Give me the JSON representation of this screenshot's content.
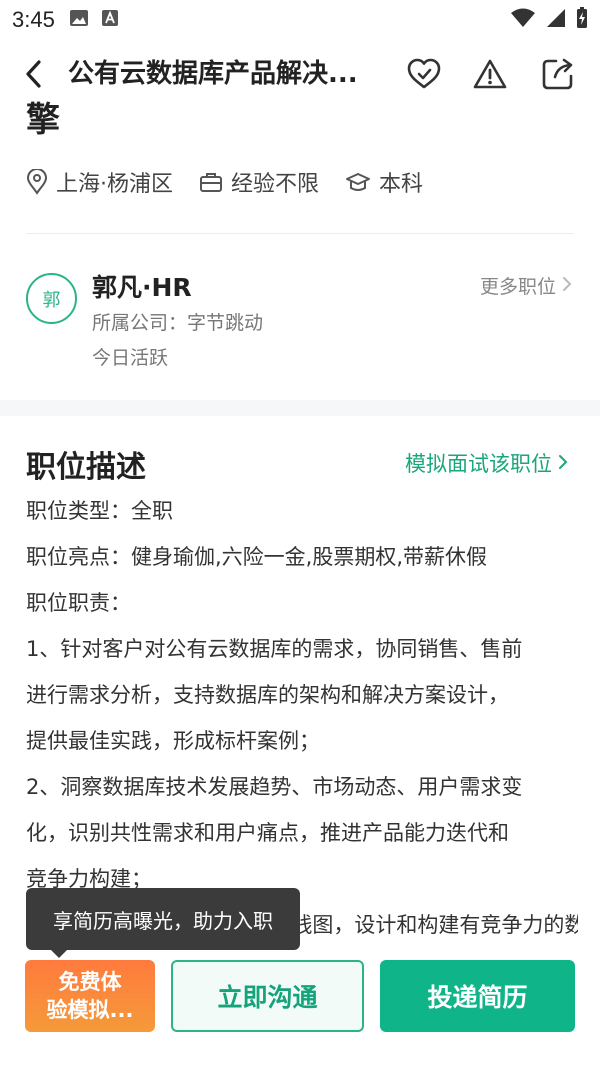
{
  "status_bar": {
    "time": "3:45",
    "icons": [
      "gallery-icon",
      "font-a-icon",
      "wifi-icon",
      "signal-icon",
      "battery-charging-icon"
    ]
  },
  "nav": {
    "title": "公有云数据库产品解决...",
    "icons": [
      "back-arrow-icon",
      "heart-check-icon",
      "warning-icon",
      "share-icon"
    ]
  },
  "job": {
    "title_tail": "擎",
    "location": "上海·杨浦区",
    "experience": "经验不限",
    "education": "本科"
  },
  "hr": {
    "avatar_text": "郭",
    "name": "郭凡·HR",
    "company": "所属公司：字节跳动",
    "activity": "今日活跃",
    "more_jobs": "更多职位"
  },
  "description": {
    "section_title": "职位描述",
    "mock_interview_link": "模拟面试该职位",
    "lines": [
      "职位类型：全职",
      "职位亮点：健身瑜伽,六险一金,股票期权,带薪休假",
      "职位职责：",
      "1、针对客户对公有云数据库的需求，协同销售、售前",
      "进行需求分析，支持数据库的架构和解决方案设计，",
      "提供最佳实践，形成标杆案例；",
      "2、洞察数据库技术发展趋势、市场动态、用户需求变",
      "化，识别共性需求和用户痛点，推进产品能力迭代和",
      "竞争力构建；",
      "3、负责产品的整体规划和路线图，设计和构建有竞争力的数"
    ]
  },
  "tooltip": {
    "text": "享简历高曝光，助力入职"
  },
  "buttons": {
    "trial_line1": "免费体",
    "trial_line2": "验模拟...",
    "chat": "立即沟通",
    "apply": "投递简历"
  },
  "colors": {
    "accent_green": "#0fb488",
    "link_green": "#1aa67b",
    "orange": "#ff7a3d",
    "tooltip_bg": "#3b3b3b"
  }
}
